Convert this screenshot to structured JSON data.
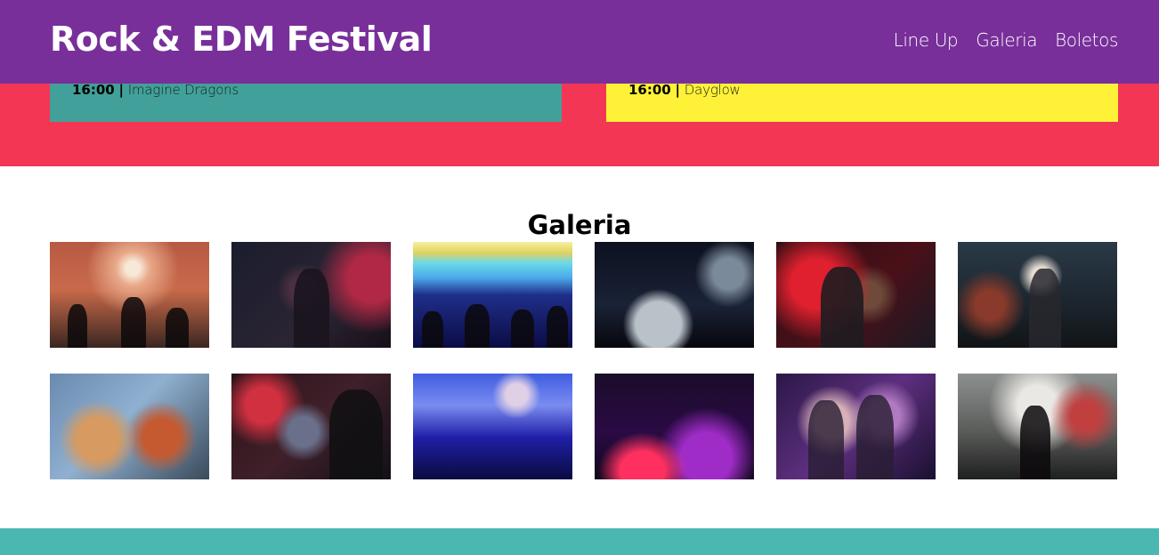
{
  "header": {
    "title": "Rock & EDM Festival",
    "nav": [
      "Line Up",
      "Galeria",
      "Boletos"
    ]
  },
  "lineup": {
    "stages": [
      {
        "time": "16:00",
        "separator": "|",
        "artist": "Imagine Dragons",
        "color": "#41a19a"
      },
      {
        "time": "16:00",
        "separator": "|",
        "artist": "Dayglow",
        "color": "#fef138"
      }
    ],
    "background": "#f43655"
  },
  "gallery": {
    "title": "Galeria",
    "photos": [
      {
        "alt": "crowd-concert-photo"
      },
      {
        "alt": "singer-performing-photo"
      },
      {
        "alt": "edm-stage-lights-photo"
      },
      {
        "alt": "dj-turntables-photo"
      },
      {
        "alt": "guitarist-red-light-photo"
      },
      {
        "alt": "female-dj-photo"
      },
      {
        "alt": "guitar-players-closeup-photo"
      },
      {
        "alt": "dj-laptop-photo"
      },
      {
        "alt": "dj-mixer-blue-photo"
      },
      {
        "alt": "dj-controller-purple-photo"
      },
      {
        "alt": "band-duo-stage-photo"
      },
      {
        "alt": "singer-smoke-photo"
      }
    ]
  },
  "colors": {
    "header": "#782f9a",
    "footer": "#4ab8b1"
  }
}
